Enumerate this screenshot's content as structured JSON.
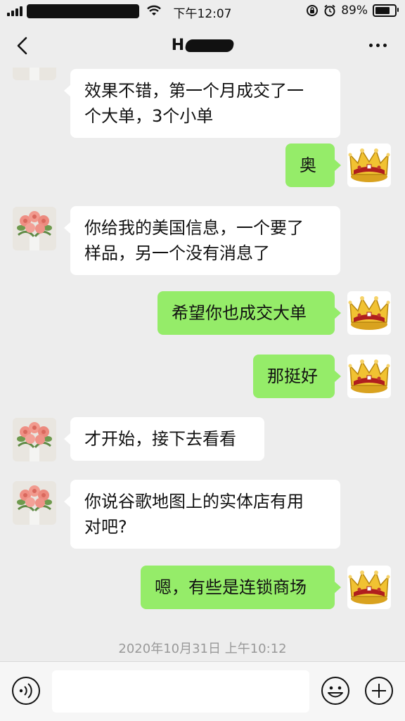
{
  "status_bar": {
    "time": "下午12:07",
    "battery": "89%",
    "battery_level": 0.89
  },
  "nav": {
    "title": "H"
  },
  "messages": [
    {
      "side": "in",
      "text_lines": [
        "效果不错，第一个月成交了一",
        "个大单，3个小单"
      ]
    },
    {
      "side": "out",
      "text_lines": [
        "奥"
      ]
    },
    {
      "side": "in",
      "text_lines": [
        "你给我的美国信息，一个要了",
        "样品，另一个没有消息了"
      ]
    },
    {
      "side": "out",
      "text_lines": [
        "希望你也成交大单"
      ]
    },
    {
      "side": "out",
      "text_lines": [
        "那挺好"
      ]
    },
    {
      "side": "in",
      "text_lines": [
        "才开始，接下去看看"
      ]
    },
    {
      "side": "in",
      "text_lines": [
        "你说谷歌地图上的实体店有用",
        "对吧?"
      ]
    },
    {
      "side": "out",
      "text_lines": [
        "嗯，有些是连锁商场"
      ]
    }
  ],
  "timestamp": "2020年10月31日 上午10:12",
  "icons": {
    "back": "back-chevron-icon",
    "more": "more-dots-icon",
    "voice": "voice-icon",
    "emoji": "emoji-icon",
    "plus": "plus-icon"
  },
  "colors": {
    "background": "#ededed",
    "incoming_bubble": "#ffffff",
    "outgoing_bubble": "#95ec69",
    "timestamp": "#999999"
  }
}
